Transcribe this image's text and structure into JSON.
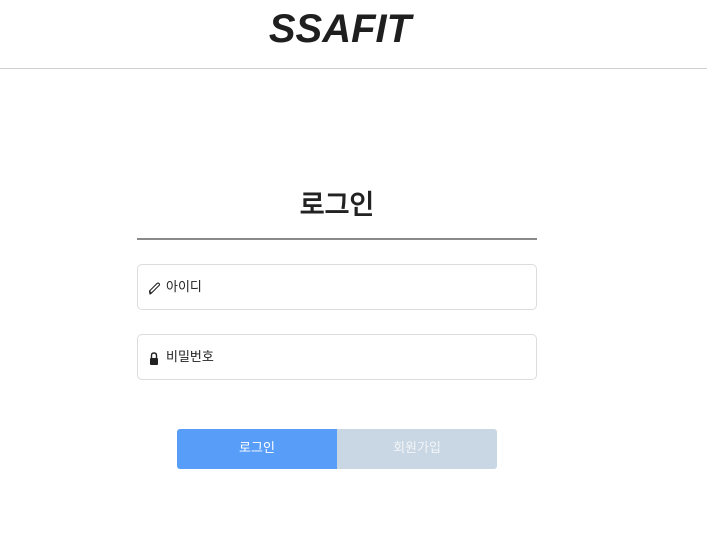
{
  "header": {
    "brand": "SSAFIT"
  },
  "login": {
    "title": "로그인",
    "id_field": {
      "icon": "pencil-icon",
      "placeholder": "아이디"
    },
    "password_field": {
      "icon": "lock-icon",
      "placeholder": "비밀번호"
    },
    "login_button": "로그인",
    "signup_button": "회원가입"
  },
  "colors": {
    "login_button": "#589ef8",
    "signup_button": "#c9d6e3",
    "title_rule": "#8a8a8a"
  }
}
